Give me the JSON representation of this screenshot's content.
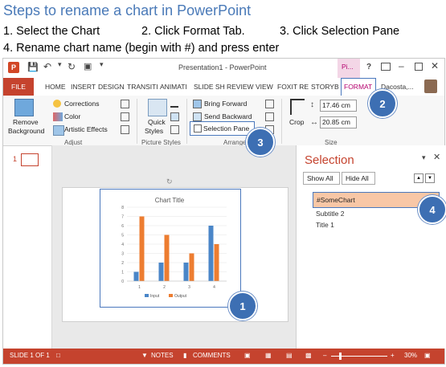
{
  "instructions": {
    "title": "Steps to rename a chart in PowerPoint",
    "step1": "1. Select the Chart",
    "step2": "2. Click Format Tab.",
    "step3": "3. Click Selection Pane",
    "step4": "4. Rename chart name (begin with #) and press enter"
  },
  "window": {
    "title": "Presentation1 - PowerPoint",
    "contextual_tab": "Pi...",
    "help": "?",
    "user": "Dacosta,..."
  },
  "tabs": [
    "FILE",
    "HOME",
    "INSERT",
    "DESIGN",
    "TRANSITI",
    "ANIMATI",
    "SLIDE SH",
    "REVIEW",
    "VIEW",
    "FOXIT RE",
    "STORYB",
    "FORMAT"
  ],
  "ribbon": {
    "adjust": {
      "remove_bg": "Remove",
      "remove_bg2": "Background",
      "corrections": "Corrections",
      "color": "Color",
      "artistic": "Artistic Effects",
      "label": "Adjust"
    },
    "picture_styles": {
      "quick_styles": "Quick",
      "quick_styles2": "Styles",
      "label": "Picture Styles"
    },
    "arrange": {
      "bring_forward": "Bring Forward",
      "send_backward": "Send Backward",
      "selection_pane": "Selection Pane",
      "label": "Arrange"
    },
    "size": {
      "crop": "Crop",
      "height": "17.46 cm",
      "width": "20.85 cm",
      "label": "Size"
    }
  },
  "thumbnail": {
    "number": "1"
  },
  "chart": {
    "title": "Chart Title",
    "legend_input": "Input",
    "legend_output": "Output"
  },
  "chart_data": {
    "type": "bar",
    "title": "Chart Title",
    "categories": [
      "1",
      "2",
      "3",
      "4"
    ],
    "series": [
      {
        "name": "Input",
        "values": [
          1,
          2,
          2,
          6
        ],
        "color": "#4a86c8"
      },
      {
        "name": "Output",
        "values": [
          7,
          5,
          3,
          4
        ],
        "color": "#ed7d31"
      }
    ],
    "yticks": [
      "0",
      "1",
      "2",
      "3",
      "4",
      "5",
      "6",
      "7",
      "8"
    ],
    "ylim": [
      0,
      8
    ]
  },
  "selection_pane": {
    "title": "Selection",
    "show_all": "Show All",
    "hide_all": "Hide All",
    "items": [
      "#SomeChart",
      "Subtitle 2",
      "Title 1"
    ]
  },
  "callouts": [
    "1",
    "2",
    "3",
    "4"
  ],
  "status": {
    "slide": "SLIDE 1 OF 1",
    "notes": "NOTES",
    "comments": "COMMENTS",
    "zoom": "30%"
  },
  "colors": {
    "accent": "#c5432e",
    "callout": "#3d6fb3",
    "selected": "#f8c7a6",
    "format_tab": "#b4006e"
  }
}
